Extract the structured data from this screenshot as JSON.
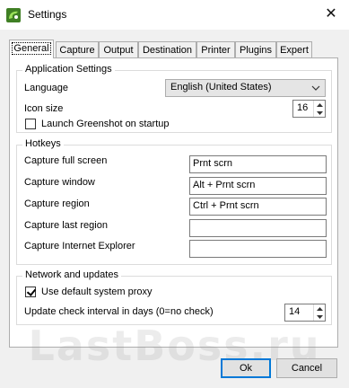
{
  "window": {
    "title": "Settings",
    "app_icon": "greenshot-icon",
    "close_glyph": "✕"
  },
  "tabs": [
    {
      "label": "General",
      "active": true
    },
    {
      "label": "Capture",
      "active": false
    },
    {
      "label": "Output",
      "active": false
    },
    {
      "label": "Destination",
      "active": false
    },
    {
      "label": "Printer",
      "active": false
    },
    {
      "label": "Plugins",
      "active": false
    },
    {
      "label": "Expert",
      "active": false
    }
  ],
  "application_settings": {
    "legend": "Application Settings",
    "language_label": "Language",
    "language_value": "English (United States)",
    "icon_size_label": "Icon size",
    "icon_size_value": "16",
    "launch_label": "Launch Greenshot on startup",
    "launch_checked": false
  },
  "hotkeys": {
    "legend": "Hotkeys",
    "items": [
      {
        "label": "Capture full screen",
        "value": "Prnt scrn"
      },
      {
        "label": "Capture window",
        "value": "Alt + Prnt scrn"
      },
      {
        "label": "Capture region",
        "value": "Ctrl + Prnt scrn"
      },
      {
        "label": "Capture last region",
        "value": ""
      },
      {
        "label": "Capture Internet Explorer",
        "value": ""
      }
    ]
  },
  "network": {
    "legend": "Network and updates",
    "proxy_label": "Use default system proxy",
    "proxy_checked": true,
    "interval_label": "Update check interval in days (0=no check)",
    "interval_value": "14"
  },
  "buttons": {
    "ok": "Ok",
    "cancel": "Cancel"
  },
  "watermark": "LastBoss.ru",
  "colors": {
    "accent": "#0078d7",
    "icon_green": "#4c9a2a"
  }
}
